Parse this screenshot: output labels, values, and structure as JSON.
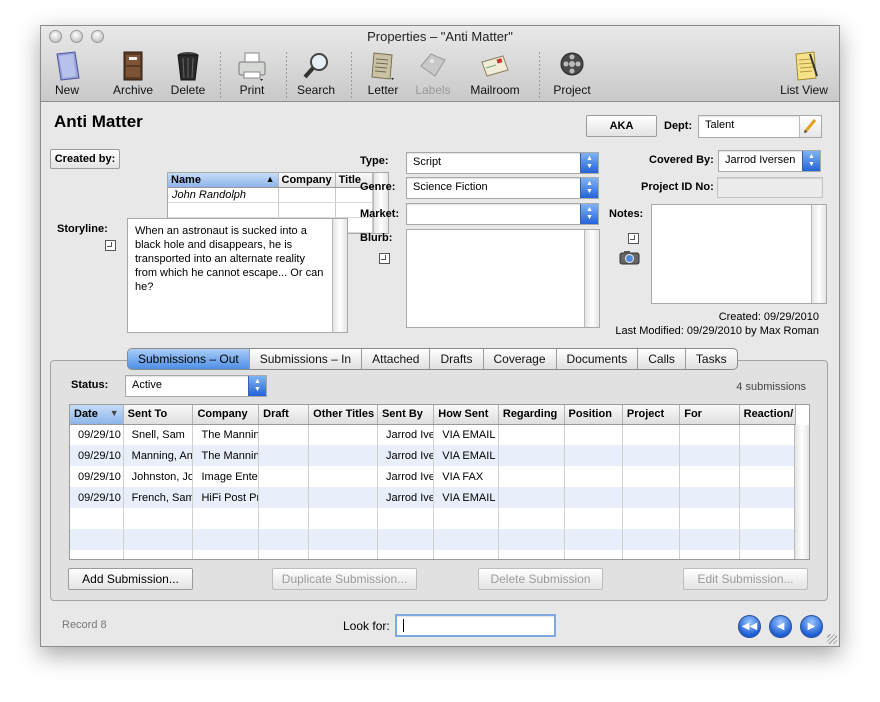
{
  "window": {
    "title": "Properties – \"Anti Matter\""
  },
  "toolbar": {
    "new": "New",
    "archive": "Archive",
    "delete": "Delete",
    "print": "Print",
    "search": "Search",
    "letter": "Letter",
    "labels": "Labels",
    "mailroom": "Mailroom",
    "project": "Project",
    "list_view": "List View"
  },
  "record": {
    "title": "Anti Matter",
    "aka_button": "AKA",
    "dept_label": "Dept:",
    "dept_value": "Talent"
  },
  "created_by": {
    "label": "Created by:",
    "columns": [
      "Name",
      "Company",
      "Title"
    ],
    "rows": [
      [
        "John Randolph",
        "",
        ""
      ],
      [
        "",
        "",
        ""
      ],
      [
        "",
        "",
        ""
      ]
    ]
  },
  "storyline": {
    "label": "Storyline:",
    "text": "When an astronaut is sucked into a black hole and disappears, he is transported into an alternate reality from which he cannot escape... Or can he?"
  },
  "fields": {
    "type_label": "Type:",
    "type_value": "Script",
    "genre_label": "Genre:",
    "genre_value": "Science Fiction",
    "market_label": "Market:",
    "market_value": "",
    "blurb_label": "Blurb:",
    "covered_by_label": "Covered By:",
    "covered_by_value": "Jarrod Iversen",
    "project_id_label": "Project ID No:",
    "project_id_value": "",
    "notes_label": "Notes:"
  },
  "meta": {
    "created": "Created: 09/29/2010",
    "modified": "Last Modified: 09/29/2010 by Max Roman"
  },
  "tabs": [
    "Submissions – Out",
    "Submissions – In",
    "Attached",
    "Drafts",
    "Coverage",
    "Documents",
    "Calls",
    "Tasks"
  ],
  "submissions": {
    "status_label": "Status:",
    "status_value": "Active",
    "count": "4 submissions",
    "columns": [
      "Date",
      "Sent To",
      "Company",
      "Draft",
      "Other Titles",
      "Sent By",
      "How Sent",
      "Regarding",
      "Position",
      "Project",
      "For",
      "Reaction/"
    ],
    "rows": [
      [
        "09/29/10",
        "Snell, Sam",
        "The Mannin",
        "",
        "",
        "Jarrod Ive",
        "VIA EMAIL",
        "",
        "",
        "",
        "",
        ""
      ],
      [
        "09/29/10",
        "Manning, An",
        "The Mannin",
        "",
        "",
        "Jarrod Ive",
        "VIA EMAIL",
        "",
        "",
        "",
        "",
        ""
      ],
      [
        "09/29/10",
        "Johnston, Jo",
        "Image Ente",
        "",
        "",
        "Jarrod Ive",
        "VIA FAX",
        "",
        "",
        "",
        "",
        ""
      ],
      [
        "09/29/10",
        "French, Sam",
        "HiFi Post Pr",
        "",
        "",
        "Jarrod Ive",
        "VIA EMAIL",
        "",
        "",
        "",
        "",
        ""
      ],
      [
        "",
        "",
        "",
        "",
        "",
        "",
        "",
        "",
        "",
        "",
        "",
        ""
      ],
      [
        "",
        "",
        "",
        "",
        "",
        "",
        "",
        "",
        "",
        "",
        "",
        ""
      ],
      [
        "",
        "",
        "",
        "",
        "",
        "",
        "",
        "",
        "",
        "",
        "",
        ""
      ]
    ],
    "add_button": "Add Submission...",
    "duplicate_button": "Duplicate Submission...",
    "delete_button": "Delete Submission",
    "edit_button": "Edit Submission..."
  },
  "footer": {
    "record": "Record 8",
    "look_for_label": "Look for:",
    "look_for_value": ""
  },
  "colors": {
    "accent": "#2663d6",
    "selection": "#8db5ea",
    "alt_row": "#e9effa"
  }
}
